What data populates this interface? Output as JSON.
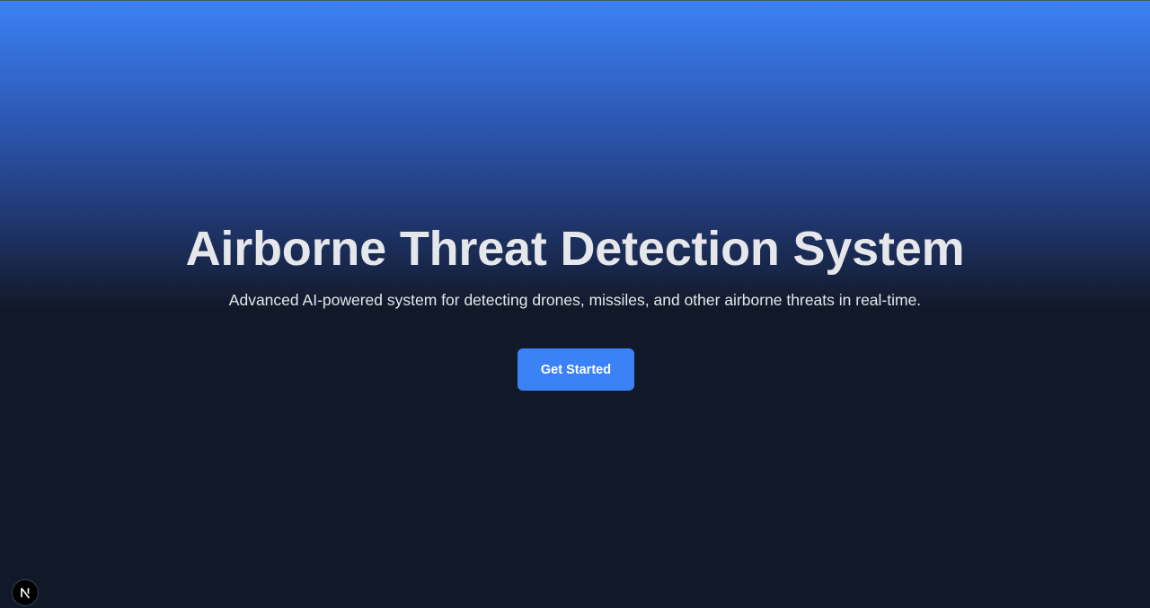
{
  "hero": {
    "title": "Airborne Threat Detection System",
    "subtitle": "Advanced AI-powered system for detecting drones, missiles, and other airborne threats in real-time.",
    "cta_label": "Get Started"
  },
  "dev_badge": {
    "icon": "nextjs-logo-icon",
    "letter": "N"
  },
  "colors": {
    "gradient_top": "#3b82f6",
    "background": "#111827",
    "text": "#e5e7eb",
    "button": "#3b82f6",
    "button_text": "#ffffff"
  }
}
